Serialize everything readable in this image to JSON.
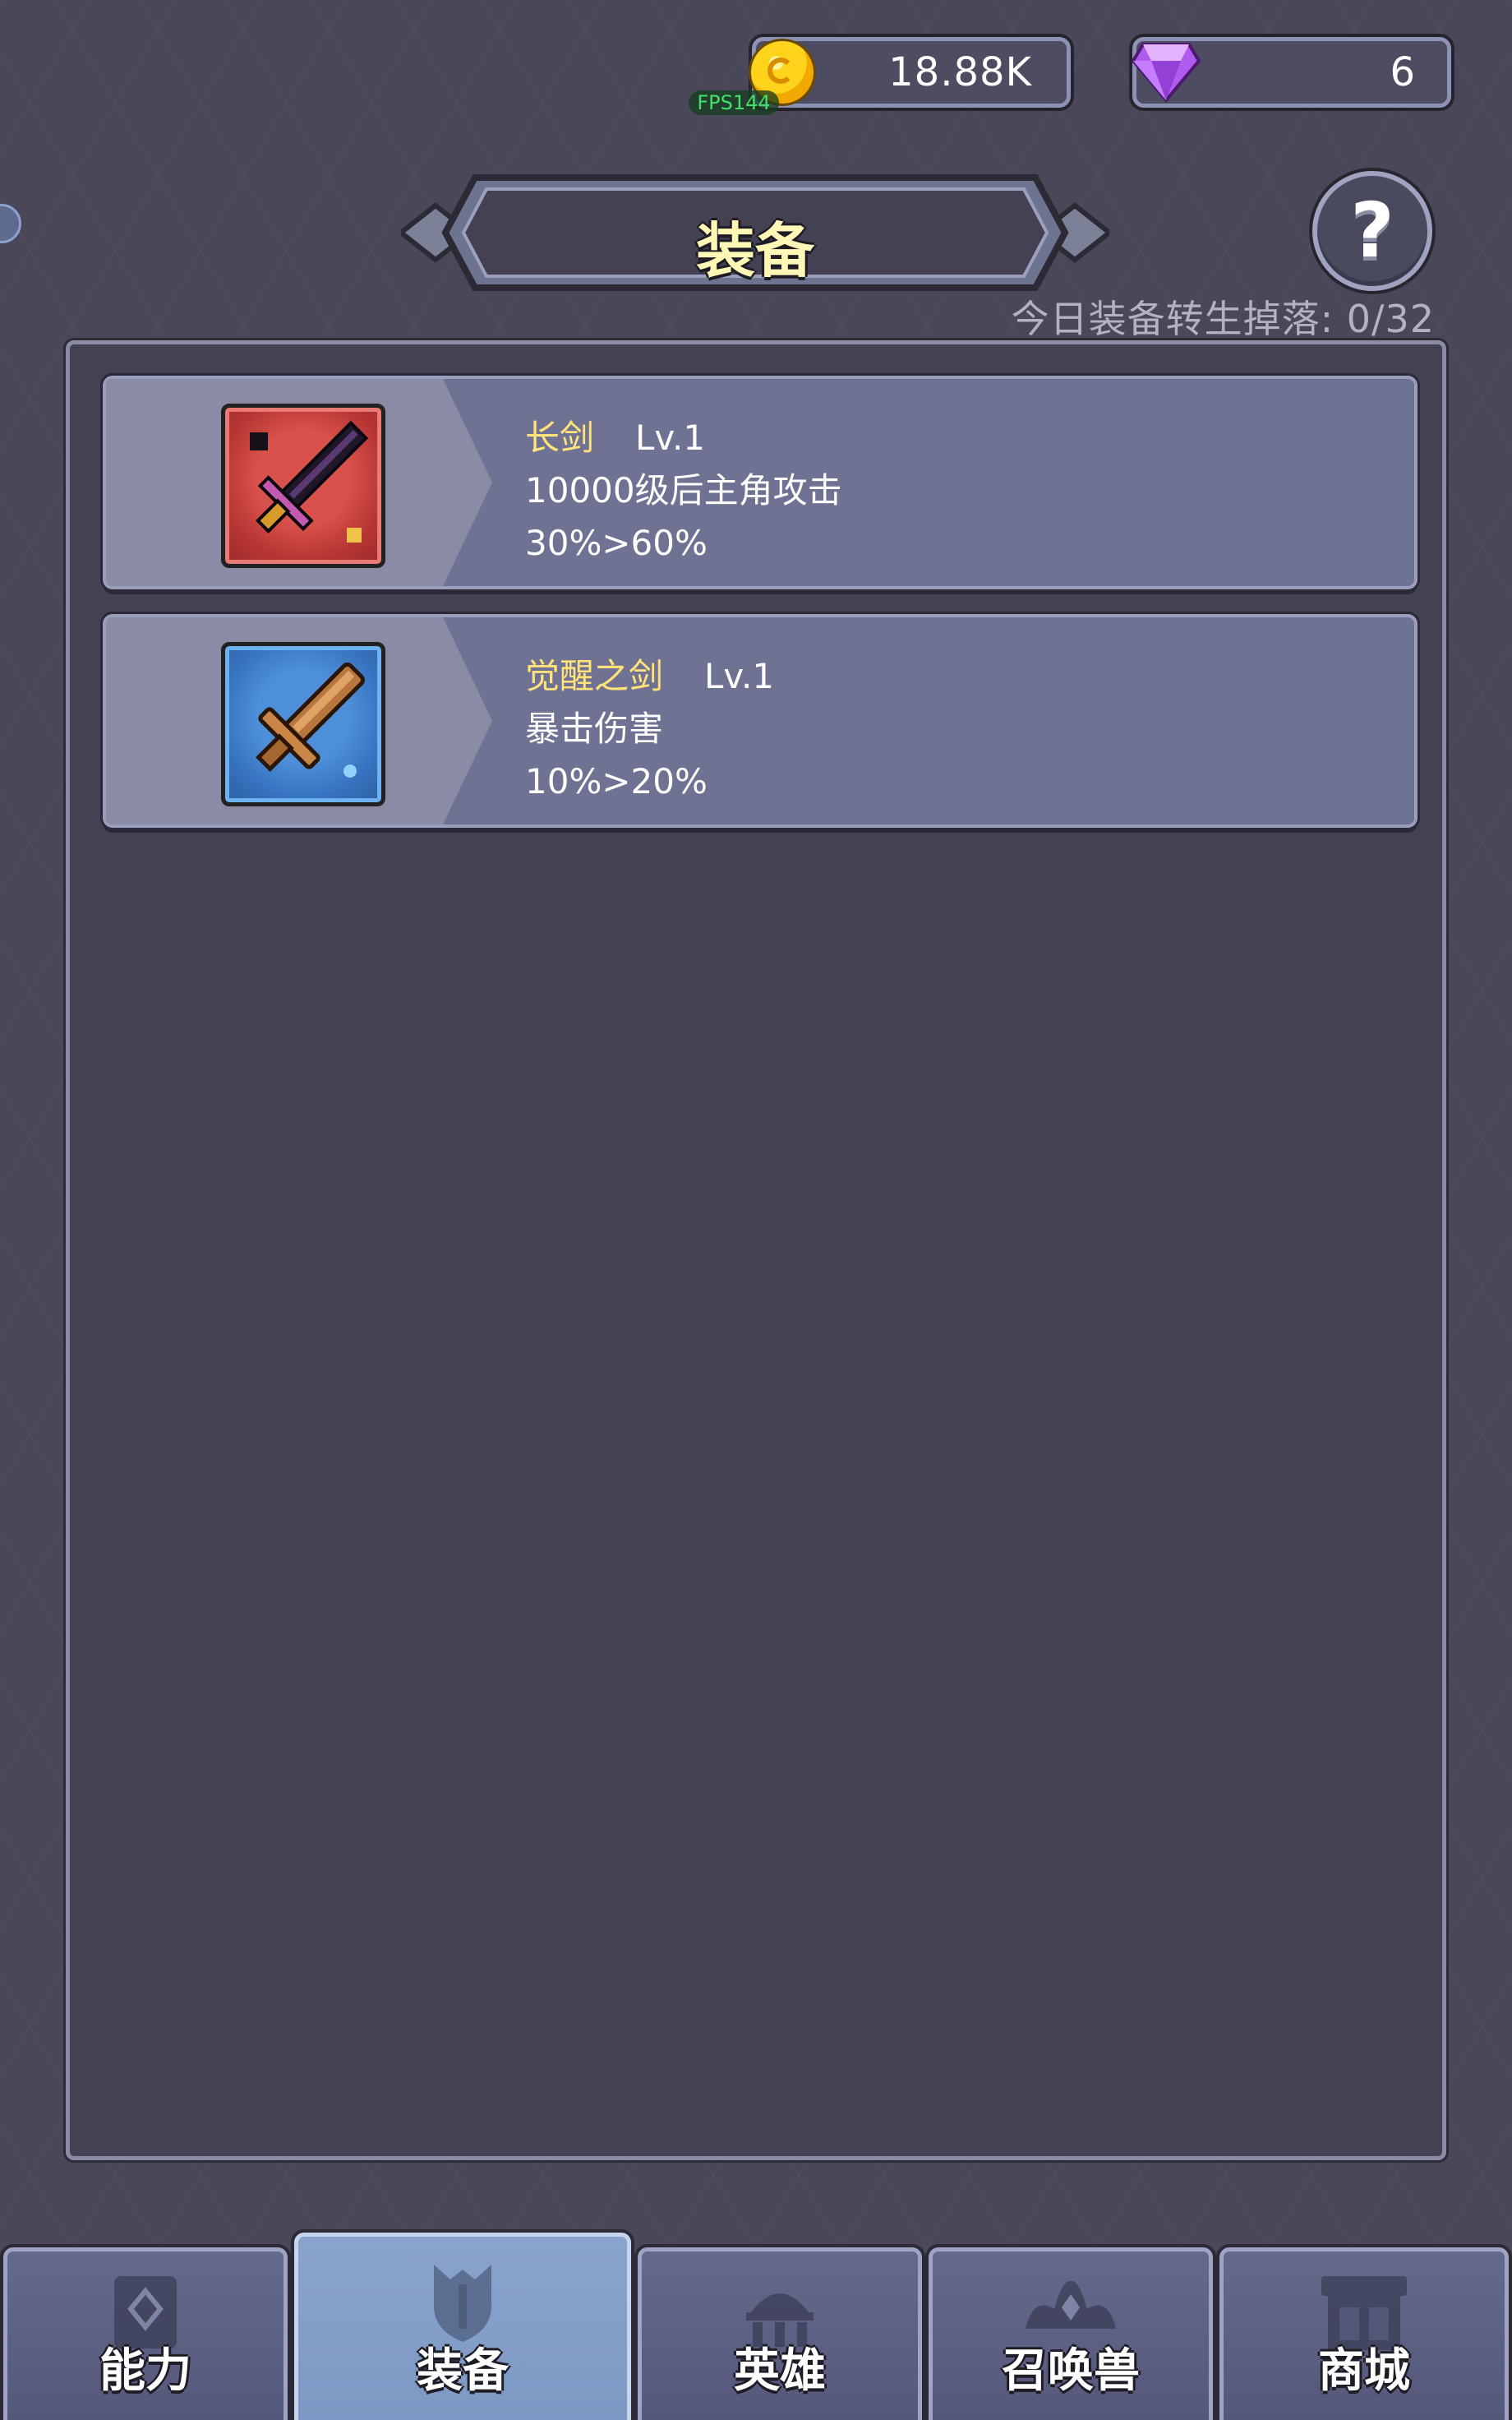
{
  "currencies": {
    "gold": {
      "value": "18.88K",
      "icon": "gold-coin-icon",
      "color": "#ffd21c"
    },
    "gems": {
      "value": "6",
      "icon": "purple-gem-icon",
      "color": "#c77dff"
    }
  },
  "fps_label": "FPS144",
  "title": "装备",
  "help_label": "?",
  "drop_count": "今日装备转生掉落: 0/32",
  "equipment": [
    {
      "name": "长剑",
      "level": "Lv.1",
      "description": "10000级后主角攻击",
      "stat": "30%>60%",
      "icon": "dark-sword-icon",
      "rarity_color": "#c53b39"
    },
    {
      "name": "觉醒之剑",
      "level": "Lv.1",
      "description": "暴击伤害",
      "stat": "10%>20%",
      "icon": "bronze-sword-icon",
      "rarity_color": "#3773c0"
    }
  ],
  "nav": {
    "tabs": [
      {
        "label": "能力",
        "icon": "ability-card-icon",
        "active": false
      },
      {
        "label": "装备",
        "icon": "equipment-shield-icon",
        "active": true
      },
      {
        "label": "英雄",
        "icon": "hero-hall-icon",
        "active": false
      },
      {
        "label": "召唤兽",
        "icon": "summon-crown-icon",
        "active": false
      },
      {
        "label": "商城",
        "icon": "shop-store-icon",
        "active": false
      }
    ]
  }
}
